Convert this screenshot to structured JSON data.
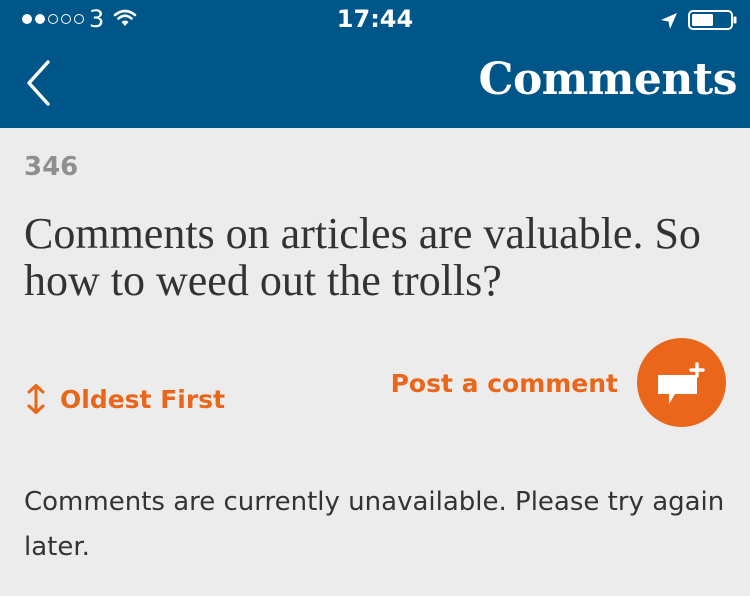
{
  "status_bar": {
    "carrier": "3",
    "time": "17:44",
    "signal_icon": "signal-dots-icon",
    "wifi_icon": "wifi-icon",
    "location_icon": "location-arrow-icon",
    "battery_icon": "battery-icon"
  },
  "nav": {
    "back_icon": "chevron-left-icon",
    "title": "Comments"
  },
  "article": {
    "comment_count": "346",
    "title": "Comments on articles are valuable. So how to weed out the trolls?"
  },
  "controls": {
    "sort_label": "Oldest First",
    "sort_icon": "sort-arrows-icon",
    "post_label": "Post a comment",
    "post_icon": "comment-add-icon"
  },
  "message": "Comments are currently unavailable. Please try again later.",
  "colors": {
    "header_bg": "#005689",
    "accent": "#e9661a",
    "page_bg": "#ececec",
    "text": "#333333",
    "muted": "#8f8f8f"
  }
}
